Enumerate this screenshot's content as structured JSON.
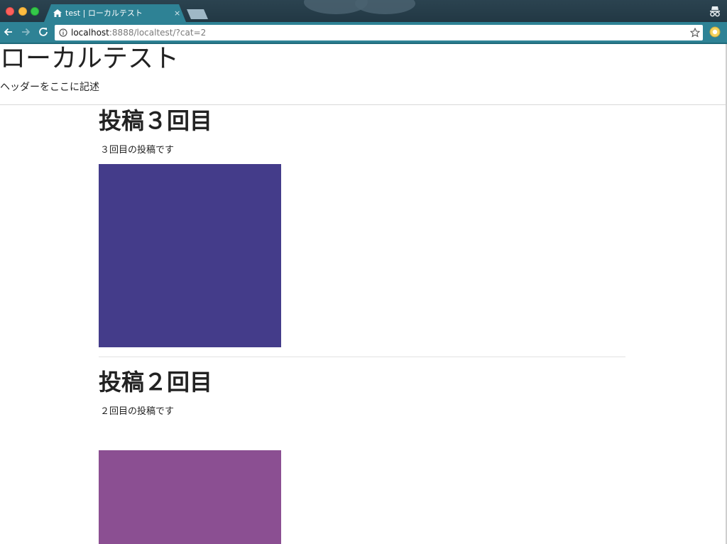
{
  "browser": {
    "tab_title": "test | ローカルテスト",
    "tab_close": "×",
    "url_host": "localhost",
    "url_rest": ":8888/localtest/?cat=2",
    "colors": {
      "chrome": "#2e8295",
      "titlebar": "#223844"
    },
    "icons": [
      "favicon-icon",
      "back-icon",
      "forward-icon",
      "reload-icon",
      "info-icon",
      "bookmark-star-icon",
      "incognito-icon",
      "extension-icon"
    ]
  },
  "site": {
    "title": "ローカルテスト",
    "description": "ヘッダーをここに記述"
  },
  "posts": [
    {
      "title": "投稿３回目",
      "body": "３回目の投稿です",
      "image_color": "#443c8a"
    },
    {
      "title": "投稿２回目",
      "body": "２回目の投稿です",
      "image_color": "#8b4f92"
    }
  ]
}
